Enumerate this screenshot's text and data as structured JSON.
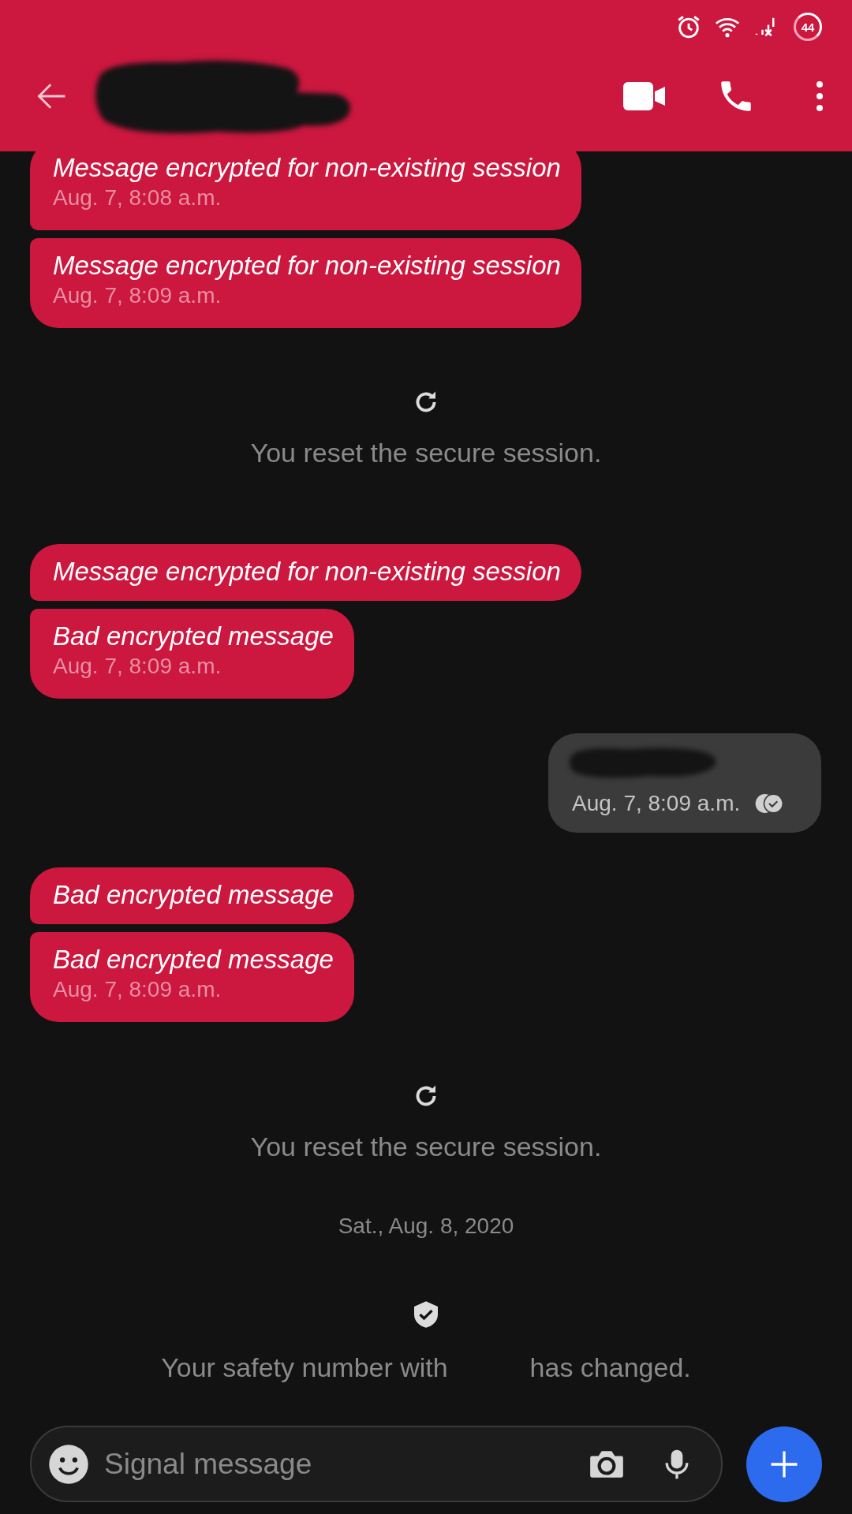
{
  "status_bar": {
    "battery": "44"
  },
  "conversation": [
    {
      "kind": "received",
      "bubbles": [
        {
          "text": "Message encrypted for non-existing session",
          "time": "Aug. 7, 8:08 a.m."
        },
        {
          "text": "Message encrypted for non-existing session",
          "time": "Aug. 7, 8:09 a.m."
        }
      ]
    },
    {
      "kind": "session_reset",
      "text": "You reset the secure session."
    },
    {
      "kind": "received",
      "bubbles": [
        {
          "text": "Message encrypted for non-existing session"
        },
        {
          "text": "Bad encrypted message",
          "time": "Aug. 7, 8:09 a.m."
        }
      ]
    },
    {
      "kind": "sent",
      "time": "Aug. 7, 8:09 a.m."
    },
    {
      "kind": "received",
      "bubbles": [
        {
          "text": "Bad encrypted message"
        },
        {
          "text": "Bad encrypted message",
          "time": "Aug. 7, 8:09 a.m."
        }
      ]
    },
    {
      "kind": "session_reset",
      "text": "You reset the secure session."
    },
    {
      "kind": "date",
      "text": "Sat., Aug. 8, 2020"
    },
    {
      "kind": "safety_number",
      "text": "Your safety number with           has changed."
    }
  ],
  "composer": {
    "placeholder": "Signal message"
  }
}
